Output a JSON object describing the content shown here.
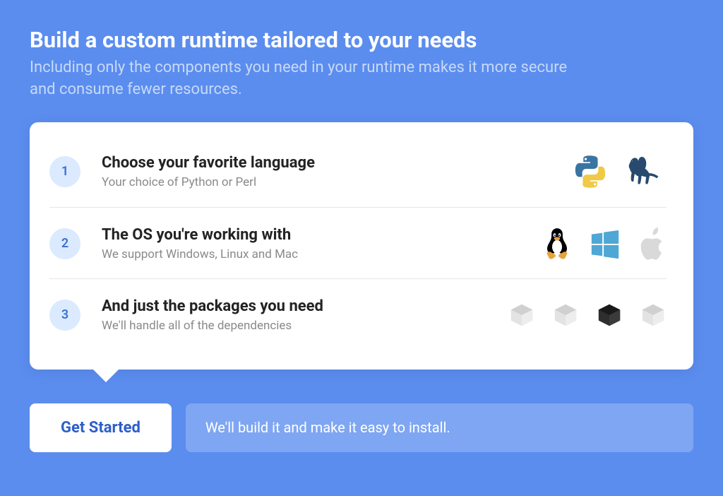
{
  "header": {
    "title": "Build a custom runtime tailored to your needs",
    "subtitle": "Including only the components you need in your runtime makes it more secure and consume fewer resources."
  },
  "steps": [
    {
      "number": "1",
      "title": "Choose your favorite language",
      "subtitle": "Your choice of Python or Perl"
    },
    {
      "number": "2",
      "title": "The OS you're working with",
      "subtitle": "We support Windows, Linux and Mac"
    },
    {
      "number": "3",
      "title": "And just the packages you need",
      "subtitle": "We'll handle all of the dependencies"
    }
  ],
  "cta": {
    "button": "Get Started",
    "banner": "We'll build it and make it easy to install."
  }
}
